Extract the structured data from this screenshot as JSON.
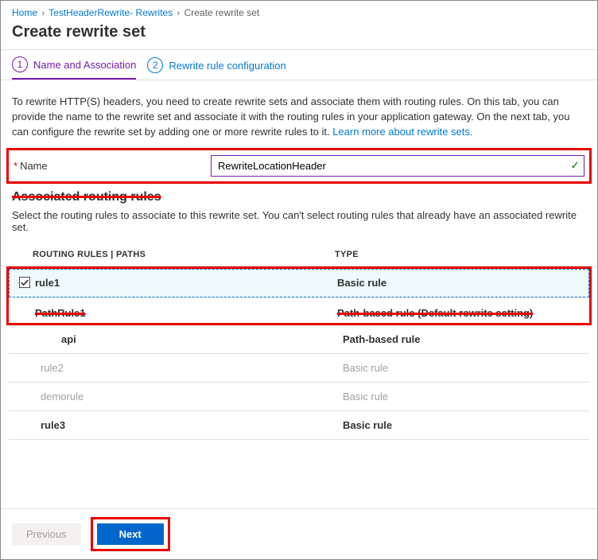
{
  "breadcrumb": {
    "home": "Home",
    "parent": "TestHeaderRewrite- Rewrites",
    "current": "Create rewrite set"
  },
  "title": "Create rewrite set",
  "tabs": {
    "step1_num": "1",
    "step1_label": "Name and Association",
    "step2_num": "2",
    "step2_label": "Rewrite rule configuration"
  },
  "description": {
    "text": "To rewrite HTTP(S) headers, you need to create rewrite sets and associate them with routing rules. On this tab, you can provide the name to the rewrite set and associate it with the routing rules in your application gateway. On the next tab, you can configure the rewrite set by adding one or more rewrite rules to it.  ",
    "link": "Learn more about rewrite sets."
  },
  "name_field": {
    "label": "Name",
    "value": "RewriteLocationHeader"
  },
  "associated_section": "Associated routing rules",
  "associated_desc": "Select the routing rules to associate to this rewrite set. You can't select routing rules that already have an associated rewrite set.",
  "table": {
    "header": {
      "col1": "ROUTING RULES | PATHS",
      "col2": "TYPE"
    },
    "rows": [
      {
        "name": "rule1",
        "type": "Basic rule"
      },
      {
        "name": "PathRule1",
        "type": "Path-based rule (Default rewrite setting)"
      },
      {
        "name": "api",
        "type": "Path-based rule"
      },
      {
        "name": "rule2",
        "type": "Basic rule"
      },
      {
        "name": "demorule",
        "type": "Basic rule"
      },
      {
        "name": "rule3",
        "type": "Basic rule"
      }
    ]
  },
  "footer": {
    "previous": "Previous",
    "next": "Next"
  }
}
